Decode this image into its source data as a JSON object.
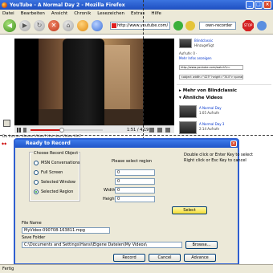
{
  "window": {
    "title": "YouTube - A Normal Day 2 - Mozilla Firefox",
    "minimize": "_",
    "maximize": "□",
    "close": "×"
  },
  "menu": [
    "Datei",
    "Bearbeiten",
    "Ansicht",
    "Chronik",
    "Lesezeichen",
    "Extras",
    "Hilfe"
  ],
  "nav": {
    "url": "http://www.youtube.com/",
    "search": "own-recorder",
    "stop_label": "STOP",
    "back_glyph": "◀",
    "forward_glyph": "▶",
    "home_glyph": "⌂",
    "reload_glyph": "↻",
    "stop_glyph": "✕"
  },
  "player": {
    "time": "1:51 / 4:19",
    "progress_fraction": 0.43
  },
  "strip_text": "Do Immer dieses Video? Hat das Video Vid?",
  "right_column": {
    "user": "Blindclassic",
    "line1": "Hinzugefügt",
    "line2": "Aufrufe: 0 ·",
    "line3": "Mehr Infos anzeigen",
    "url_field": "http://www.youtube.com/watch?v=",
    "embed_field": "<object width=\"425\" height=\"344\"><param name=",
    "section_more": "Mehr von Blindclassic",
    "section_similar": "Ähnliche Videos",
    "related": [
      {
        "title": "A Normal Day",
        "meta": "1:05 Aufrufe"
      },
      {
        "title": "A Normal Day 3",
        "meta": "2:14 Aufrufe"
      },
      {
        "title": "A Normal Day 4",
        "meta": "3:02 Aufrufe"
      }
    ]
  },
  "dialog": {
    "title": "Ready to Record",
    "close": "×",
    "group_label": "Choose Record Object",
    "options": [
      "MSN Conversations",
      "Full Screen",
      "Selected Window",
      "Selected Region"
    ],
    "selected_option": "Selected Region",
    "region_prompt": "Please select region",
    "instructions": "Double click or Enter Key to select\nRight click or Esc Key to cancel",
    "fields": [
      {
        "label": "X",
        "value": "0"
      },
      {
        "label": "Y",
        "value": "0"
      },
      {
        "label": "Width",
        "value": "0"
      },
      {
        "label": "Height",
        "value": "0"
      }
    ],
    "select_button": "Select",
    "file_name_label": "File Name",
    "file_name_value": "MyVideo-090708-163811.mpg",
    "save_folder_label": "Save Folder",
    "save_folder_value": "C:\\Documents and Settings\\Hansi\\Eigene Dateien\\My Videos\\",
    "browse_button": "Browse...",
    "record_button": "Record",
    "cancel_button": "Cancel",
    "advance_button": "Advance"
  },
  "status_bar": "Fertig"
}
